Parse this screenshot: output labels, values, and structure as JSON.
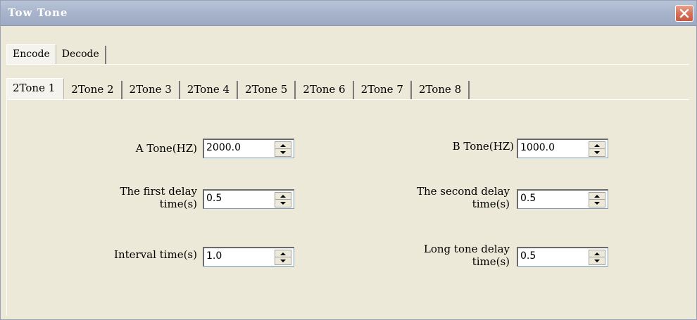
{
  "window": {
    "title": "Tow Tone"
  },
  "outer_tabs": [
    {
      "label": "Encode",
      "active": true
    },
    {
      "label": "Decode",
      "active": false
    }
  ],
  "inner_tabs": [
    {
      "label": "2Tone 1",
      "active": true
    },
    {
      "label": "2Tone 2",
      "active": false
    },
    {
      "label": "2Tone 3",
      "active": false
    },
    {
      "label": "2Tone 4",
      "active": false
    },
    {
      "label": "2Tone 5",
      "active": false
    },
    {
      "label": "2Tone 6",
      "active": false
    },
    {
      "label": "2Tone 7",
      "active": false
    },
    {
      "label": "2Tone 8",
      "active": false
    }
  ],
  "fields": {
    "a_tone": {
      "label": "A Tone(HZ)",
      "value": "2000.0"
    },
    "b_tone": {
      "label": "B Tone(HZ)",
      "value": "1000.0"
    },
    "first_delay": {
      "label_line1": "The first delay",
      "label_line2": "time(s)",
      "value": "0.5"
    },
    "second_delay": {
      "label_line1": "The second delay",
      "label_line2": "time(s)",
      "value": "0.5"
    },
    "interval": {
      "label": "Interval time(s)",
      "value": "1.0"
    },
    "long_tone": {
      "label_line1": "Long tone delay",
      "label_line2": "time(s)",
      "value": "0.5"
    }
  },
  "colors": {
    "titlebar": "#a9b5cc",
    "window_bg": "#ece9d8",
    "close_button": "#d5725a"
  }
}
